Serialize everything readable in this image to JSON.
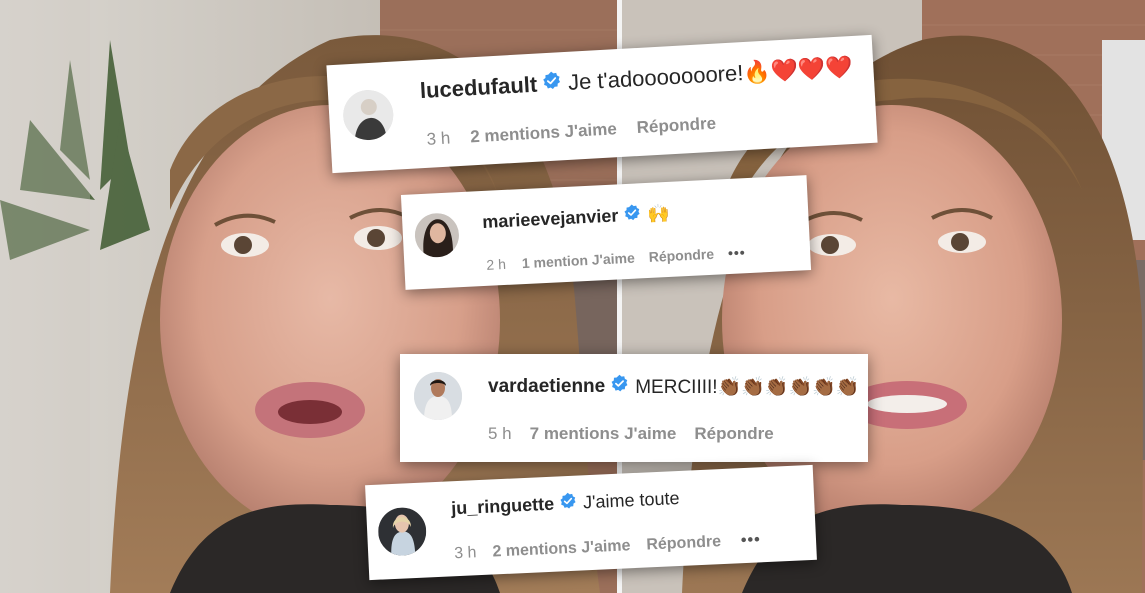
{
  "comments": [
    {
      "username": "lucedufault",
      "text": "Je t'adooooooore!🔥❤️❤️❤️",
      "time": "3 h",
      "likes": "2 mentions J'aime",
      "reply": "Répondre",
      "more": ""
    },
    {
      "username": "marieevejanvier",
      "text": "🙌",
      "time": "2 h",
      "likes": "1 mention J'aime",
      "reply": "Répondre",
      "more": "•••"
    },
    {
      "username": "vardaetienne",
      "text": "MERCIIII!👏🏾👏🏾👏🏾👏🏾👏🏾👏🏾",
      "time": "5 h",
      "likes": "7 mentions J'aime",
      "reply": "Répondre",
      "more": ""
    },
    {
      "username": "ju_ringuette",
      "text": "J'aime toute",
      "time": "3 h",
      "likes": "2 mentions J'aime",
      "reply": "Répondre",
      "more": "•••"
    }
  ],
  "colors": {
    "verified_blue": "#3897f0",
    "username": "#262626",
    "meta_gray": "#8e8e8e",
    "card_bg": "#ffffff",
    "divider": "#f4f4f4"
  },
  "icons": {
    "verified": "verified-badge-icon",
    "more": "more-options-icon"
  }
}
